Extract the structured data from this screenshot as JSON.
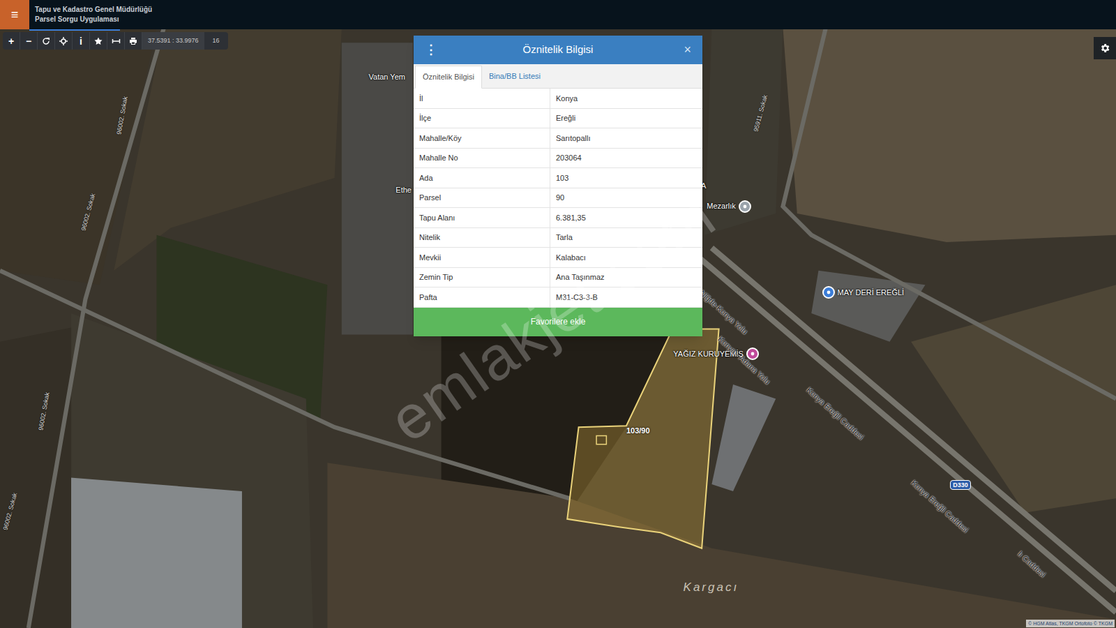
{
  "header": {
    "menu_icon": "≡",
    "title_line1": "Tapu ve Kadastro Genel Müdürlüğü",
    "title_line2": "Parsel Sorgu Uygulaması"
  },
  "toolbar": {
    "buttons": [
      {
        "kind": "glyph",
        "glyph": "+"
      },
      {
        "kind": "glyph",
        "glyph": "−"
      },
      {
        "kind": "refresh",
        "glyph": ""
      },
      {
        "kind": "locate",
        "glyph": ""
      },
      {
        "kind": "glyph",
        "glyph": "i"
      },
      {
        "kind": "star",
        "glyph": ""
      },
      {
        "kind": "measure",
        "glyph": ""
      },
      {
        "kind": "print",
        "glyph": ""
      }
    ],
    "coordinates": "37.5391 : 33.9976",
    "zoom": "16"
  },
  "popup": {
    "menu_icon": "⋮",
    "title": "Öznitelik Bilgisi",
    "close_icon": "×",
    "tabs": [
      {
        "label": "Öznitelik Bilgisi",
        "selected": true
      },
      {
        "label": "Bina/BB Listesi",
        "selected": false
      }
    ],
    "rows": [
      [
        "İl",
        "Konya"
      ],
      [
        "İlçe",
        "Ereğli"
      ],
      [
        "Mahalle/Köy",
        "Sarıtopallı"
      ],
      [
        "Mahalle No",
        "203064"
      ],
      [
        "Ada",
        "103"
      ],
      [
        "Parsel",
        "90"
      ],
      [
        "Tapu Alanı",
        "6.381,35"
      ],
      [
        "Nitelik",
        "Tarla"
      ],
      [
        "Mevkii",
        "Kalabacı"
      ],
      [
        "Zemin Tip",
        "Ana Taşınmaz"
      ],
      [
        "Pafta",
        "M31-C3-3-B"
      ]
    ],
    "button": "Favorilere ekle"
  },
  "map": {
    "parcel_label": "103/90",
    "labels": [
      {
        "text": "Vatan Yem",
        "kind": "place",
        "color": ""
      },
      {
        "text": "Ethe",
        "kind": "place",
        "color": ""
      },
      {
        "text": "A",
        "kind": "place",
        "color": ""
      },
      {
        "text": "Mezarlık",
        "kind": "poi",
        "color": "#9aa3ab"
      },
      {
        "text": "MAY DERİ EREĞLİ",
        "kind": "poi",
        "color": "#3b7dd8"
      },
      {
        "text": "YAĞIZ KURUYEMİŞ",
        "kind": "poi",
        "color": "#c04a9a"
      },
      {
        "text": "96002. Sokak",
        "kind": "street",
        "color": ""
      },
      {
        "text": "96002. Sokak",
        "kind": "street",
        "color": ""
      },
      {
        "text": "96002. Sokak",
        "kind": "street",
        "color": ""
      },
      {
        "text": "96002. Sokak",
        "kind": "street",
        "color": ""
      },
      {
        "text": "95911. Sokak",
        "kind": "street",
        "color": ""
      },
      {
        "text": "Niğde-Konya Yolu",
        "kind": "road",
        "color": ""
      },
      {
        "text": "Konya - Adana Yolu",
        "kind": "road",
        "color": ""
      },
      {
        "text": "Konya Ereğli Caddesi",
        "kind": "road",
        "color": ""
      },
      {
        "text": "Konya Ereğli Caddesi",
        "kind": "road",
        "color": ""
      },
      {
        "text": "D330",
        "kind": "shield",
        "color": ""
      },
      {
        "text": "lı Caddesi",
        "kind": "road",
        "color": ""
      },
      {
        "text": "Kargacı",
        "kind": "area",
        "color": ""
      }
    ],
    "watermark": "emlakjet.com",
    "attribution": "© HGM Atlas, TKGM Ortofoto © TKGM"
  }
}
